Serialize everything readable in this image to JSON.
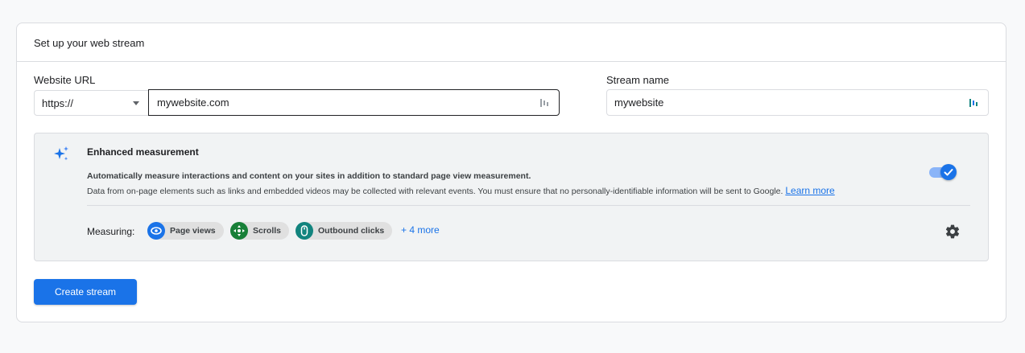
{
  "card": {
    "title": "Set up your web stream"
  },
  "website_url": {
    "label": "Website URL",
    "protocol": "https://",
    "value": "mywebsite.com"
  },
  "stream_name": {
    "label": "Stream name",
    "value": "mywebsite"
  },
  "enhanced_measurement": {
    "title": "Enhanced measurement",
    "line1": "Automatically measure interactions and content on your sites in addition to standard page view measurement.",
    "line2": "Data from on-page elements such as links and embedded videos may be collected with relevant events. You must ensure that no personally-identifiable information will be sent to Google.",
    "learn_more": "Learn more",
    "toggle_on": true,
    "measuring_label": "Measuring:",
    "chips": [
      {
        "label": "Page views",
        "icon": "eye-icon",
        "color": "#1a73e8"
      },
      {
        "label": "Scrolls",
        "icon": "scroll-arrows-icon",
        "color": "#188038"
      },
      {
        "label": "Outbound clicks",
        "icon": "mouse-icon",
        "color": "#12847e"
      }
    ],
    "more": "+ 4 more"
  },
  "actions": {
    "create_label": "Create stream"
  },
  "colors": {
    "accent": "#1a73e8",
    "border": "#dadce0",
    "panel": "#f1f3f4"
  }
}
